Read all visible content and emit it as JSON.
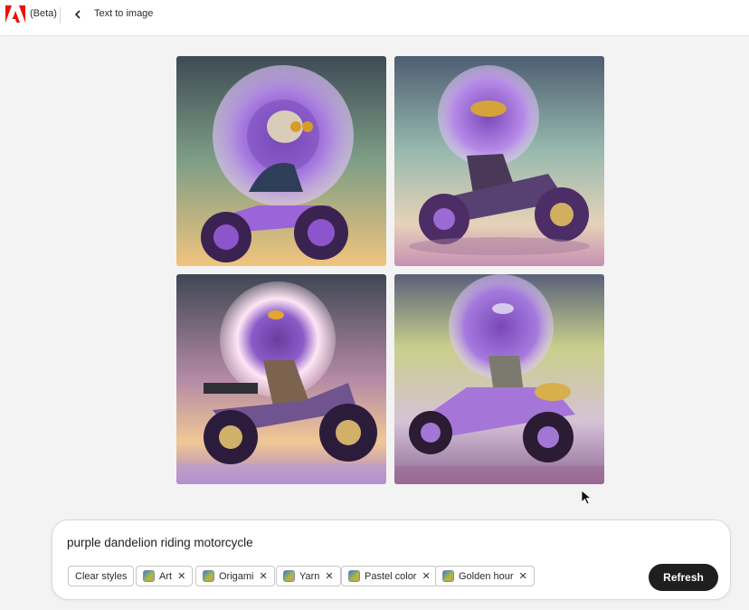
{
  "header": {
    "logo_icon": "adobe-logo-icon",
    "beta_label": "(Beta)",
    "back_icon": "chevron-left-icon",
    "title": "Text to image"
  },
  "gallery": {
    "images": [
      {
        "name": "generated-image-1",
        "subject": "purple dandelion riding motorcycle"
      },
      {
        "name": "generated-image-2",
        "subject": "purple dandelion riding motorcycle"
      },
      {
        "name": "generated-image-3",
        "subject": "purple dandelion riding motorcycle"
      },
      {
        "name": "generated-image-4",
        "subject": "purple dandelion riding motorcycle"
      }
    ]
  },
  "prompt_panel": {
    "prompt_text": "purple dandelion riding motorcycle",
    "clear_styles_label": "Clear styles",
    "styles": [
      {
        "label": "Art",
        "remove_icon": "close-icon"
      },
      {
        "label": "Origami",
        "remove_icon": "close-icon"
      },
      {
        "label": "Yarn",
        "remove_icon": "close-icon"
      },
      {
        "label": "Pastel color",
        "remove_icon": "close-icon"
      },
      {
        "label": "Golden hour",
        "remove_icon": "close-icon"
      }
    ],
    "refresh_label": "Refresh"
  },
  "colors": {
    "adobe_red": "#eb1000",
    "refresh_bg": "#1f1f1f",
    "page_bg": "#f3f3f3"
  }
}
